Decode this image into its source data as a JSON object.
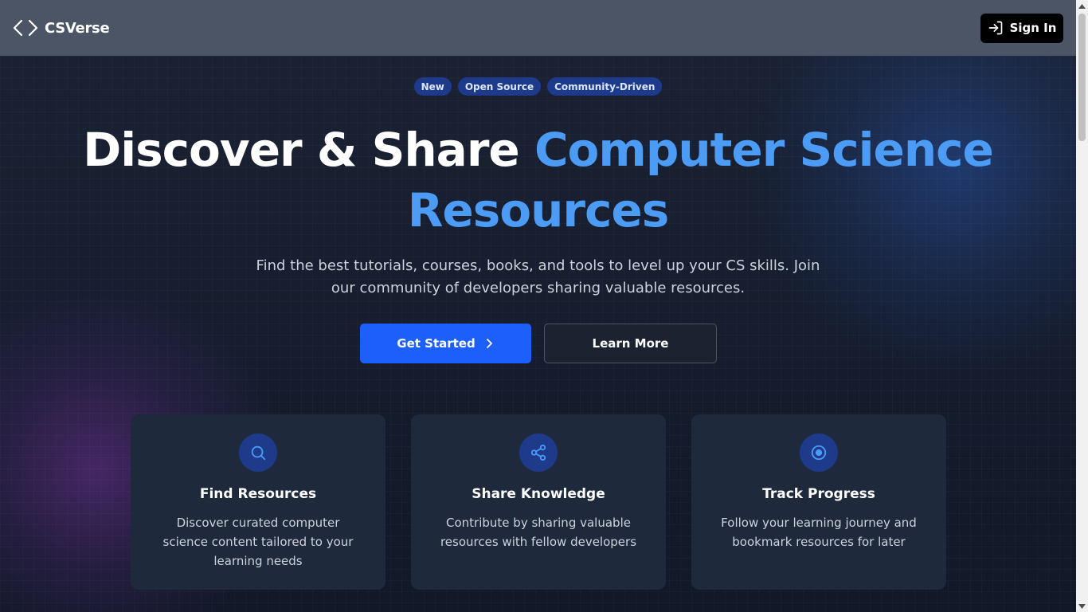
{
  "header": {
    "brand_name": "CSVerse",
    "brand_icon": "code-brackets-icon",
    "signin_label": "Sign In",
    "signin_icon": "login-icon"
  },
  "badges": [
    "New",
    "Open Source",
    "Community-Driven"
  ],
  "hero": {
    "title_plain": "Discover & Share",
    "title_accent_1": "Computer Science",
    "title_accent_2": "Resources",
    "subtitle": "Find the best tutorials, courses, books, and tools to level up your CS skills. Join our community of developers sharing valuable resources.",
    "primary_label": "Get Started",
    "secondary_label": "Learn More"
  },
  "cards": [
    {
      "title": "Find Resources",
      "desc": "Discover curated computer science content tailored to your learning needs",
      "icon": "search-icon"
    },
    {
      "title": "Share Knowledge",
      "desc": "Contribute by sharing valuable resources with fellow developers",
      "icon": "share-icon"
    },
    {
      "title": "Track Progress",
      "desc": "Follow your learning journey and bookmark resources for later",
      "icon": "target-icon"
    }
  ],
  "colors": {
    "accent": "#4c9cf5",
    "primary_button": "#1d5ffb",
    "header_bg": "#4b5565",
    "card_bg": "#1e293b",
    "badge_bg": "#1e3a8a"
  }
}
